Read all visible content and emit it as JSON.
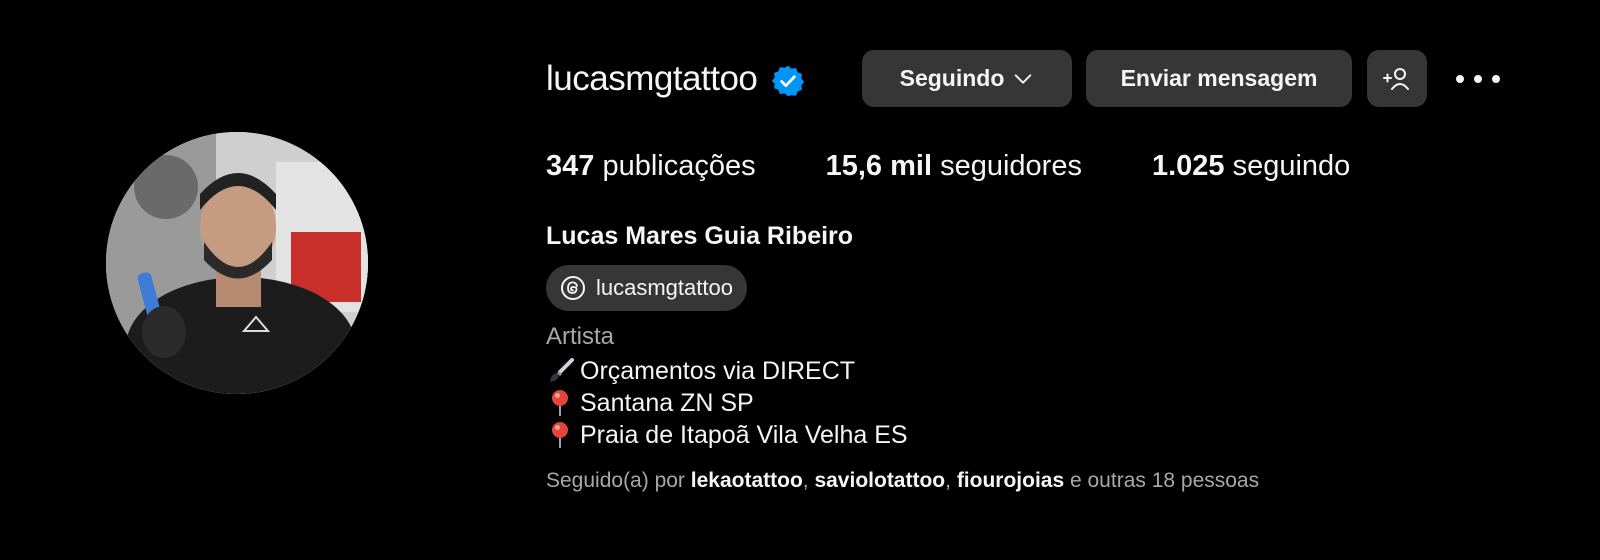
{
  "profile": {
    "username": "lucasmgtattoo",
    "verified": true,
    "full_name": "Lucas Mares Guia Ribeiro",
    "threads_handle": "lucasmgtattoo",
    "category": "Artista",
    "avatar_alt": "profile-photo"
  },
  "actions": {
    "following_label": "Seguindo",
    "message_label": "Enviar mensagem"
  },
  "stats": {
    "posts_count": "347",
    "posts_label": "publicações",
    "followers_count": "15,6 mil",
    "followers_label": "seguidores",
    "following_count": "1.025",
    "following_label": "seguindo"
  },
  "bio": {
    "line1": "Orçamentos via DIRECT",
    "line2": "Santana ZN SP",
    "line3": "Praia de Itapoã Vila Velha ES"
  },
  "followed_by": {
    "prefix": "Seguido(a) por",
    "accounts": [
      "lekaotattoo",
      "saviolotattoo",
      "fiourojoias"
    ],
    "sep1": ", ",
    "sep2": ", ",
    "suffix": " e outras 18 pessoas"
  },
  "colors": {
    "background": "#000000",
    "button_bg": "#363636",
    "verified_blue": "#0095f6",
    "secondary_text": "#a8a8a8"
  },
  "icons": {
    "verified": "verified-badge-icon",
    "chevron": "chevron-down-icon",
    "add_person": "add-person-icon",
    "more": "more-options-icon",
    "threads": "threads-icon",
    "brush": "paintbrush-emoji-icon",
    "pin": "round-pushpin-emoji-icon"
  }
}
